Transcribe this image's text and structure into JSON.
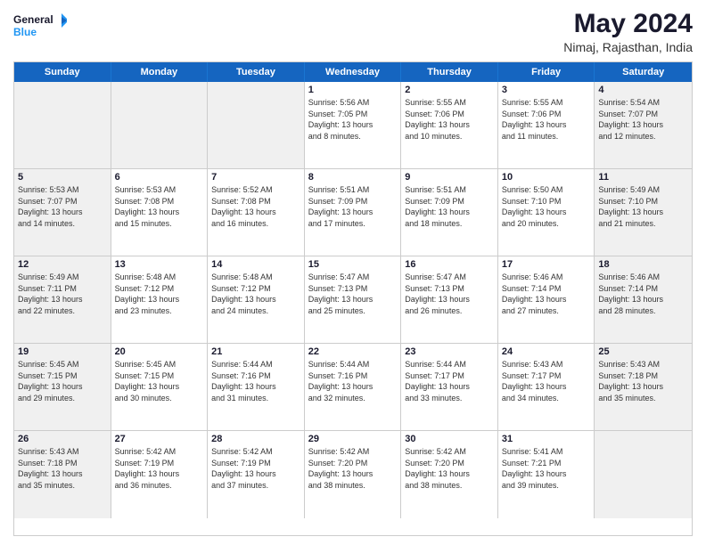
{
  "logo": {
    "line1": "General",
    "line2": "Blue"
  },
  "title": "May 2024",
  "subtitle": "Nimaj, Rajasthan, India",
  "days_of_week": [
    "Sunday",
    "Monday",
    "Tuesday",
    "Wednesday",
    "Thursday",
    "Friday",
    "Saturday"
  ],
  "weeks": [
    [
      {
        "day": "",
        "info": ""
      },
      {
        "day": "",
        "info": ""
      },
      {
        "day": "",
        "info": ""
      },
      {
        "day": "1",
        "info": "Sunrise: 5:56 AM\nSunset: 7:05 PM\nDaylight: 13 hours\nand 8 minutes."
      },
      {
        "day": "2",
        "info": "Sunrise: 5:55 AM\nSunset: 7:06 PM\nDaylight: 13 hours\nand 10 minutes."
      },
      {
        "day": "3",
        "info": "Sunrise: 5:55 AM\nSunset: 7:06 PM\nDaylight: 13 hours\nand 11 minutes."
      },
      {
        "day": "4",
        "info": "Sunrise: 5:54 AM\nSunset: 7:07 PM\nDaylight: 13 hours\nand 12 minutes."
      }
    ],
    [
      {
        "day": "5",
        "info": "Sunrise: 5:53 AM\nSunset: 7:07 PM\nDaylight: 13 hours\nand 14 minutes."
      },
      {
        "day": "6",
        "info": "Sunrise: 5:53 AM\nSunset: 7:08 PM\nDaylight: 13 hours\nand 15 minutes."
      },
      {
        "day": "7",
        "info": "Sunrise: 5:52 AM\nSunset: 7:08 PM\nDaylight: 13 hours\nand 16 minutes."
      },
      {
        "day": "8",
        "info": "Sunrise: 5:51 AM\nSunset: 7:09 PM\nDaylight: 13 hours\nand 17 minutes."
      },
      {
        "day": "9",
        "info": "Sunrise: 5:51 AM\nSunset: 7:09 PM\nDaylight: 13 hours\nand 18 minutes."
      },
      {
        "day": "10",
        "info": "Sunrise: 5:50 AM\nSunset: 7:10 PM\nDaylight: 13 hours\nand 20 minutes."
      },
      {
        "day": "11",
        "info": "Sunrise: 5:49 AM\nSunset: 7:10 PM\nDaylight: 13 hours\nand 21 minutes."
      }
    ],
    [
      {
        "day": "12",
        "info": "Sunrise: 5:49 AM\nSunset: 7:11 PM\nDaylight: 13 hours\nand 22 minutes."
      },
      {
        "day": "13",
        "info": "Sunrise: 5:48 AM\nSunset: 7:12 PM\nDaylight: 13 hours\nand 23 minutes."
      },
      {
        "day": "14",
        "info": "Sunrise: 5:48 AM\nSunset: 7:12 PM\nDaylight: 13 hours\nand 24 minutes."
      },
      {
        "day": "15",
        "info": "Sunrise: 5:47 AM\nSunset: 7:13 PM\nDaylight: 13 hours\nand 25 minutes."
      },
      {
        "day": "16",
        "info": "Sunrise: 5:47 AM\nSunset: 7:13 PM\nDaylight: 13 hours\nand 26 minutes."
      },
      {
        "day": "17",
        "info": "Sunrise: 5:46 AM\nSunset: 7:14 PM\nDaylight: 13 hours\nand 27 minutes."
      },
      {
        "day": "18",
        "info": "Sunrise: 5:46 AM\nSunset: 7:14 PM\nDaylight: 13 hours\nand 28 minutes."
      }
    ],
    [
      {
        "day": "19",
        "info": "Sunrise: 5:45 AM\nSunset: 7:15 PM\nDaylight: 13 hours\nand 29 minutes."
      },
      {
        "day": "20",
        "info": "Sunrise: 5:45 AM\nSunset: 7:15 PM\nDaylight: 13 hours\nand 30 minutes."
      },
      {
        "day": "21",
        "info": "Sunrise: 5:44 AM\nSunset: 7:16 PM\nDaylight: 13 hours\nand 31 minutes."
      },
      {
        "day": "22",
        "info": "Sunrise: 5:44 AM\nSunset: 7:16 PM\nDaylight: 13 hours\nand 32 minutes."
      },
      {
        "day": "23",
        "info": "Sunrise: 5:44 AM\nSunset: 7:17 PM\nDaylight: 13 hours\nand 33 minutes."
      },
      {
        "day": "24",
        "info": "Sunrise: 5:43 AM\nSunset: 7:17 PM\nDaylight: 13 hours\nand 34 minutes."
      },
      {
        "day": "25",
        "info": "Sunrise: 5:43 AM\nSunset: 7:18 PM\nDaylight: 13 hours\nand 35 minutes."
      }
    ],
    [
      {
        "day": "26",
        "info": "Sunrise: 5:43 AM\nSunset: 7:18 PM\nDaylight: 13 hours\nand 35 minutes."
      },
      {
        "day": "27",
        "info": "Sunrise: 5:42 AM\nSunset: 7:19 PM\nDaylight: 13 hours\nand 36 minutes."
      },
      {
        "day": "28",
        "info": "Sunrise: 5:42 AM\nSunset: 7:19 PM\nDaylight: 13 hours\nand 37 minutes."
      },
      {
        "day": "29",
        "info": "Sunrise: 5:42 AM\nSunset: 7:20 PM\nDaylight: 13 hours\nand 38 minutes."
      },
      {
        "day": "30",
        "info": "Sunrise: 5:42 AM\nSunset: 7:20 PM\nDaylight: 13 hours\nand 38 minutes."
      },
      {
        "day": "31",
        "info": "Sunrise: 5:41 AM\nSunset: 7:21 PM\nDaylight: 13 hours\nand 39 minutes."
      },
      {
        "day": "",
        "info": ""
      }
    ]
  ]
}
